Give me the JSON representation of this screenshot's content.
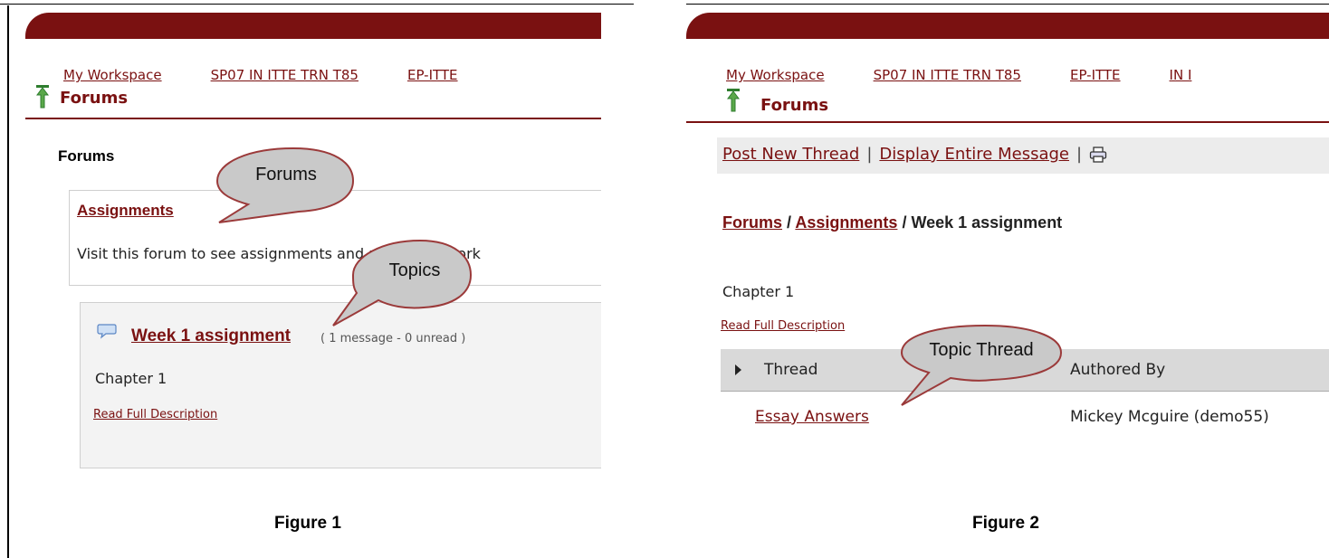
{
  "figure1": {
    "nav": {
      "my_workspace": "My Workspace",
      "site1": "SP07 IN ITTE TRN T85",
      "site2": "EP-ITTE"
    },
    "tool_title": "Forums",
    "forums_heading": "Forums",
    "forum": {
      "title": "Assignments",
      "description": "Visit this forum to see assignments and post homework"
    },
    "topic": {
      "title": "Week 1 assignment",
      "count": "( 1 message - 0 unread )",
      "description": "Chapter 1",
      "read_full": "Read Full Description"
    },
    "callouts": {
      "forums": "Forums",
      "topics": "Topics"
    },
    "caption": "Figure 1"
  },
  "figure2": {
    "nav": {
      "my_workspace": "My Workspace",
      "site1": "SP07 IN ITTE TRN T85",
      "site2": "EP-ITTE",
      "site3": "IN I"
    },
    "tool_title": "Forums",
    "toolbar": {
      "post_new_thread": "Post New Thread",
      "separator": "|",
      "display_entire": "Display Entire Message",
      "print_icon": "printer-icon"
    },
    "breadcrumb": {
      "forums": "Forums",
      "sep": "/",
      "assignments": "Assignments",
      "current": "/ Week 1 assignment"
    },
    "description": "Chapter 1",
    "read_full": "Read Full Description",
    "table": {
      "headers": [
        "Thread",
        "Authored By"
      ],
      "rows": [
        {
          "thread": "Essay Answers",
          "author": "Mickey Mcguire (demo55)"
        }
      ]
    },
    "callouts": {
      "topic_thread": "Topic Thread"
    },
    "caption": "Figure 2"
  },
  "colors": {
    "brand": "#7a1111",
    "callout_fill": "#c9c9c9",
    "callout_border": "#9b3a3a",
    "toolbar_bg": "#ececec",
    "table_head_bg": "#d9d9d9"
  }
}
